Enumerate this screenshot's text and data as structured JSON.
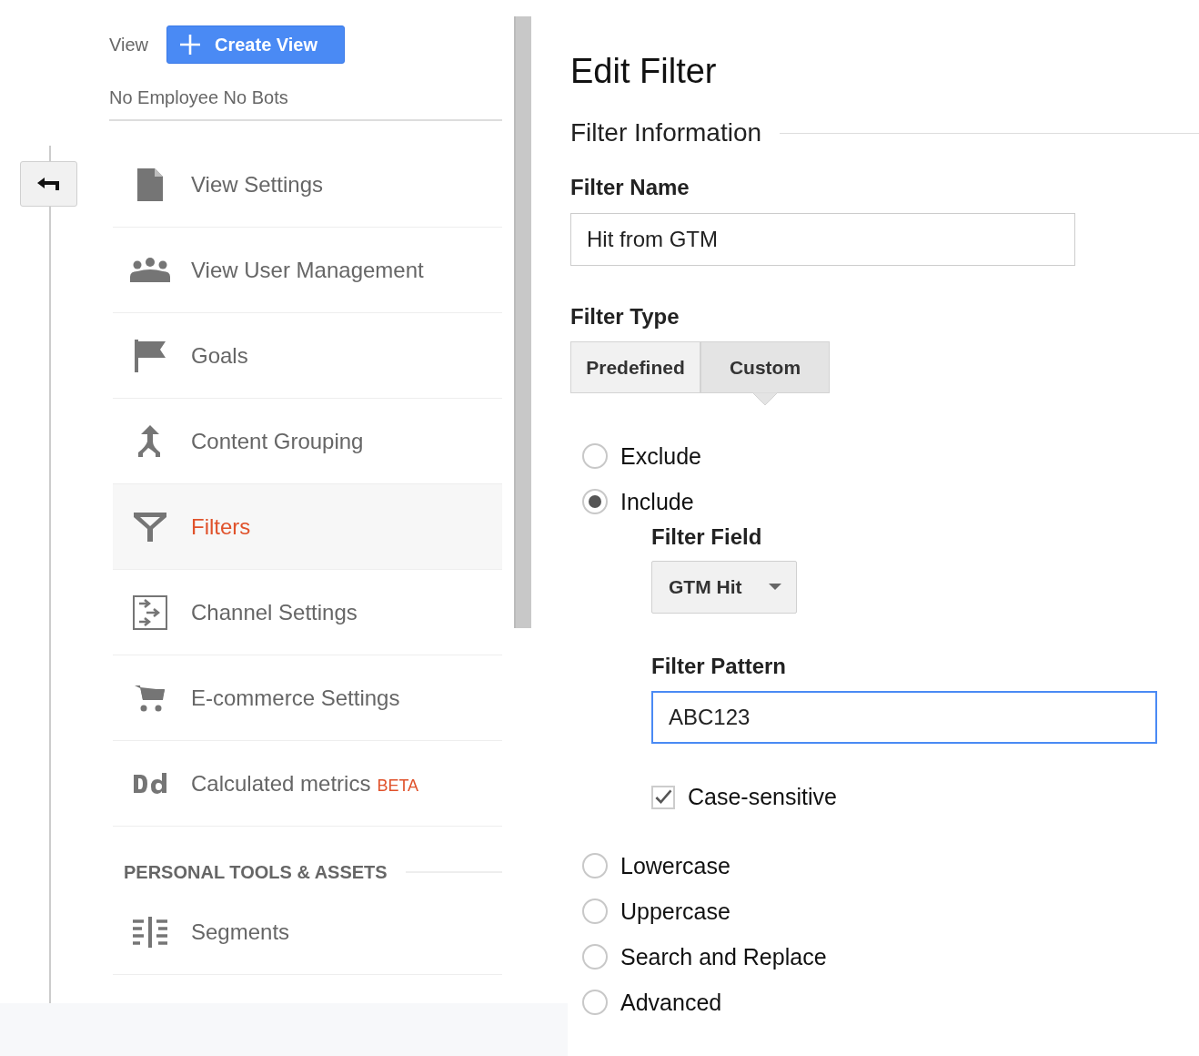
{
  "view_header": {
    "label": "View",
    "create_button": "Create View",
    "view_name": "No Employee No Bots"
  },
  "sidebar": {
    "items": [
      {
        "label": "View Settings",
        "selected": false
      },
      {
        "label": "View User Management",
        "selected": false
      },
      {
        "label": "Goals",
        "selected": false
      },
      {
        "label": "Content Grouping",
        "selected": false
      },
      {
        "label": "Filters",
        "selected": true
      },
      {
        "label": "Channel Settings",
        "selected": false
      },
      {
        "label": "E-commerce Settings",
        "selected": false
      },
      {
        "label": "Calculated metrics",
        "badge": "BETA",
        "selected": false
      }
    ],
    "section": {
      "title": "PERSONAL TOOLS & ASSETS",
      "items": [
        {
          "label": "Segments",
          "selected": false
        }
      ]
    }
  },
  "main": {
    "title": "Edit Filter",
    "section_title": "Filter Information",
    "filter_name": {
      "label": "Filter Name",
      "value": "Hit from GTM"
    },
    "filter_type": {
      "label": "Filter Type",
      "options": [
        {
          "label": "Predefined",
          "selected": false
        },
        {
          "label": "Custom",
          "selected": true
        }
      ]
    },
    "custom_options": [
      {
        "label": "Exclude",
        "selected": false
      },
      {
        "label": "Include",
        "selected": true,
        "settings": {
          "field_label": "Filter Field",
          "field_value": "GTM Hit",
          "pattern_label": "Filter Pattern",
          "pattern_value": "ABC123",
          "case_label": "Case-sensitive",
          "case_checked": true
        }
      },
      {
        "label": "Lowercase",
        "selected": false
      },
      {
        "label": "Uppercase",
        "selected": false
      },
      {
        "label": "Search and Replace",
        "selected": false
      },
      {
        "label": "Advanced",
        "selected": false
      }
    ]
  }
}
